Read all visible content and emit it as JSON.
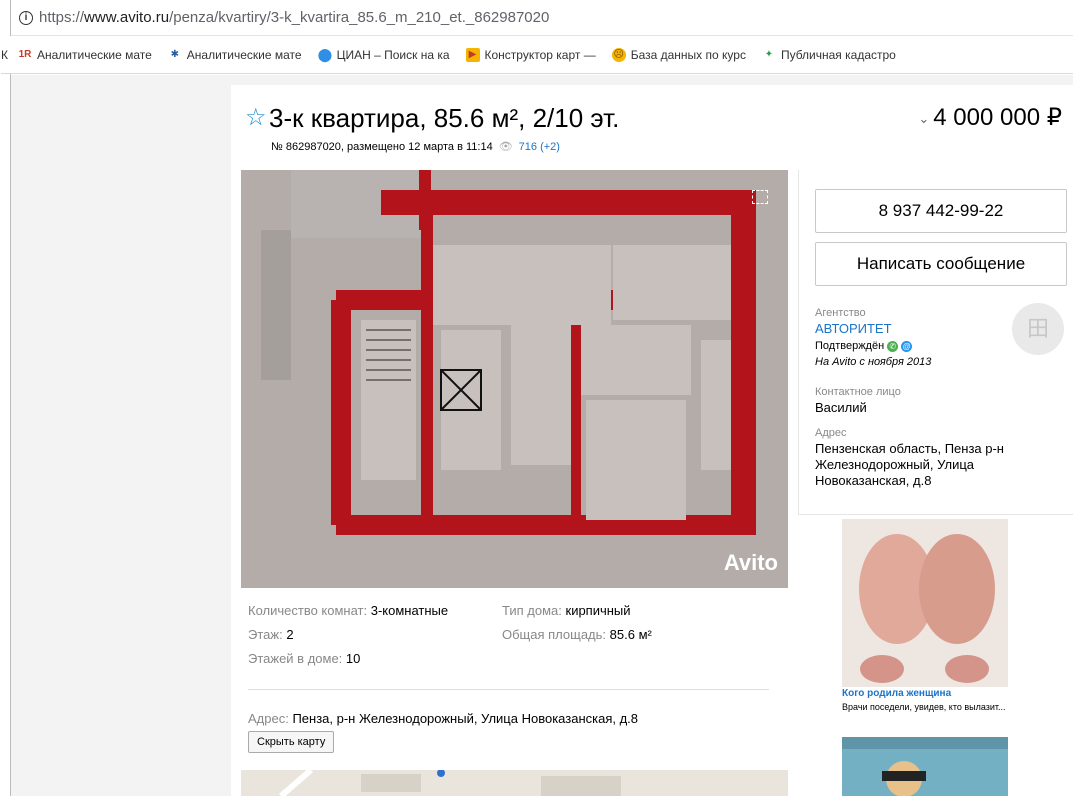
{
  "browser": {
    "url_prefix": "https://",
    "url_host": "www.avito.ru",
    "url_path": "/penza/kvartiry/3-k_kvartira_85.6_m_210_et._862987020",
    "bookmarks": [
      {
        "label": "Аналитические мате",
        "icon": "1r-icon",
        "color": "#c43b2c"
      },
      {
        "label": "Аналитические мате",
        "icon": "analytics-icon",
        "color": "#2b5b9e"
      },
      {
        "label": "ЦИАН – Поиск на ка",
        "icon": "location-pin-icon",
        "color": "#2f8ee5"
      },
      {
        "label": "Конструктор карт —",
        "icon": "yandex-maps-icon",
        "color": "#f5b400"
      },
      {
        "label": "База данных по курс",
        "icon": "emoji-icon",
        "color": "#f5b400"
      },
      {
        "label": "Публичная кадастро",
        "icon": "cadastre-icon",
        "color": "#2e9b4c"
      }
    ],
    "bookmarks_prefix": "К"
  },
  "listing": {
    "title": "3-к квартира, 85.6 м², 2/10 эт.",
    "number_text": "№ 862987020, размещено 12 марта в 11:14",
    "views": "716 (+2)",
    "price": "4 000 000 ₽",
    "watermark": "Avito"
  },
  "seller": {
    "phone": "8 937 442-99-22",
    "message_button": "Написать сообщение",
    "agency_label": "Агентство",
    "agency_name": "АВТОРИТЕТ",
    "verified": "Подтверждён",
    "since": "На Avito с ноября 2013",
    "contact_label": "Контактное лицо",
    "contact_name": "Василий",
    "address_label": "Адрес",
    "address": "Пензенская область, Пенза р-н Железнодорожный, Улица Новоказанская, д.8"
  },
  "params": {
    "rooms_label": "Количество комнат: ",
    "rooms_value": "3-комнатные",
    "house_type_label": "Тип дома: ",
    "house_type_value": "кирпичный",
    "floor_label": "Этаж: ",
    "floor_value": "2",
    "area_label": "Общая площадь: ",
    "area_value": "85.6 м²",
    "floors_label": "Этажей в доме: ",
    "floors_value": "10"
  },
  "address_block": {
    "label": "Адрес: ",
    "value": "Пенза, р-н Железнодорожный, Улица Новоказанская, д.8",
    "hide_map": "Скрыть карту"
  },
  "ads": {
    "ad1_title": "Кого родила женщина",
    "ad1_text": "Врачи поседели, увидев, кто вылазит..."
  }
}
